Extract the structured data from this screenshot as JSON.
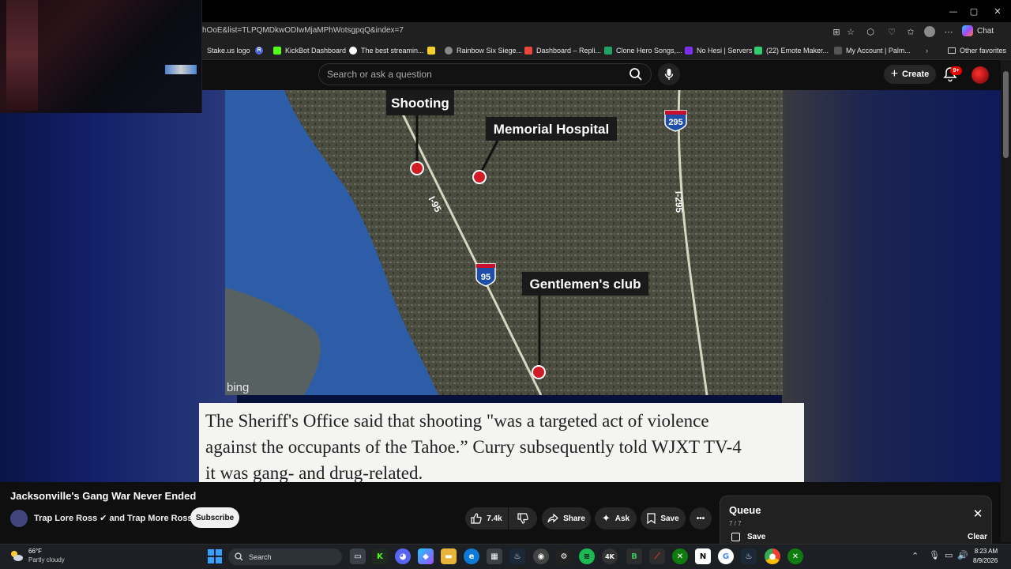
{
  "browser": {
    "url": "hOoE&list=TLPQMDkwODIwMjaMPhWotsgpqQ&index=7",
    "chat_label": "Chat",
    "window_controls": {
      "minimize": "—",
      "maximize": "▢",
      "close": "✕"
    },
    "bookmarks": [
      {
        "label": "Stake.us logo",
        "color": "#1b2a3a"
      },
      {
        "label": "",
        "color": "#4a68d8",
        "glyph": "R"
      },
      {
        "label": "KickBot Dashboard",
        "color": "#53fc18"
      },
      {
        "label": "The best streamin...",
        "color": "#ffffff"
      },
      {
        "label": "",
        "color": "#f2d024"
      },
      {
        "label": "Rainbow Six Siege...",
        "color": "#888888"
      },
      {
        "label": "Dashboard – Repli...",
        "color": "#e8453c"
      },
      {
        "label": "Clone Hero Songs,...",
        "color": "#21a366"
      },
      {
        "label": "No Hesi | Servers",
        "color": "#7b2ff7"
      },
      {
        "label": "(22) Emote Maker...",
        "color": "#2ecc71"
      },
      {
        "label": "My Account | Palm...",
        "color": "#555555"
      }
    ],
    "other_favorites": "Other favorites"
  },
  "youtube": {
    "search_placeholder": "Search or ask a question",
    "create_label": "Create",
    "notification_count": "9+"
  },
  "video": {
    "map_labels": {
      "shooting": "Shooting",
      "memorial": "Memorial Hospital",
      "club": "Gentlemen's club",
      "i95_shield": "95",
      "i295_shield": "295",
      "i95_road": "I-95",
      "i295_road": "I-295",
      "bing": "bing"
    },
    "caption_lines": [
      "The Sheriff's Office said that shooting \"was a targeted act of violence",
      "against the occupants of the Tahoe.” Curry subsequently told WJXT TV-4",
      "it was gang- and drug-related."
    ]
  },
  "below_video": {
    "title": "Jacksonville's Gang War Never Ended",
    "channel": "Trap Lore Ross ✔ and Trap More Ross",
    "subscribe": "Subscribe",
    "likes": "7.4k",
    "share": "Share",
    "ask": "Ask",
    "save": "Save"
  },
  "queue": {
    "title": "Queue",
    "position": "7 / 7",
    "save_label": "Save",
    "clear_label": "Clear"
  },
  "taskbar": {
    "weather_temp": "66°F",
    "weather_desc": "Partly cloudy",
    "search_label": "Search",
    "time": "8:23 AM",
    "date": "8/9/2026"
  }
}
